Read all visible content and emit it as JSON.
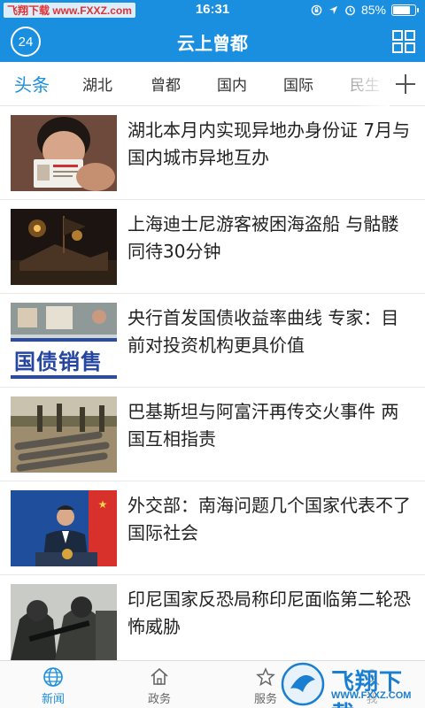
{
  "status_bar": {
    "watermark_text": "飞翔下载 www.FXXZ.com",
    "time": "16:31",
    "battery_text": "85%",
    "battery_level": 0.85,
    "icons": [
      "rotation-lock-icon",
      "location-icon",
      "alarm-icon"
    ]
  },
  "header": {
    "logo_text": "24",
    "title": "云上曾都",
    "menu_icon": "grid-icon"
  },
  "tabs": {
    "items": [
      {
        "label": "头条",
        "active": true
      },
      {
        "label": "湖北",
        "active": false
      },
      {
        "label": "曾都",
        "active": false
      },
      {
        "label": "国内",
        "active": false
      },
      {
        "label": "国际",
        "active": false
      },
      {
        "label": "民生",
        "active": false
      }
    ],
    "add_icon": "plus-icon"
  },
  "news": [
    {
      "headline": "湖北本月内实现异地办身份证 7月与国内城市异地互办",
      "thumb": "id-card"
    },
    {
      "headline": "上海迪士尼游客被困海盗船 与骷髅同待30分钟",
      "thumb": "pirate-ship"
    },
    {
      "headline": "央行首发国债收益率曲线 专家：目前对投资机构更具价值",
      "thumb_text": "国债销售"
    },
    {
      "headline": "巴基斯坦与阿富汗再传交火事件 两国互相指责",
      "thumb": "soldiers"
    },
    {
      "headline": "外交部：南海问题几个国家代表不了国际社会",
      "thumb": "press-conference"
    },
    {
      "headline": "印尼国家反恐局称印尼面临第二轮恐怖威胁",
      "thumb": "armed-police"
    }
  ],
  "bottom_nav": {
    "items": [
      {
        "label": "新闻",
        "icon": "globe-icon",
        "active": true
      },
      {
        "label": "政务",
        "icon": "home-icon",
        "active": false
      },
      {
        "label": "服务",
        "icon": "star-icon",
        "active": false
      },
      {
        "label": "我",
        "icon": "user-icon",
        "active": false
      }
    ]
  },
  "watermark": {
    "title": "飞翔下载",
    "url": "WWW.FXXZ.COM"
  },
  "colors": {
    "brand": "#1a8fe0"
  }
}
